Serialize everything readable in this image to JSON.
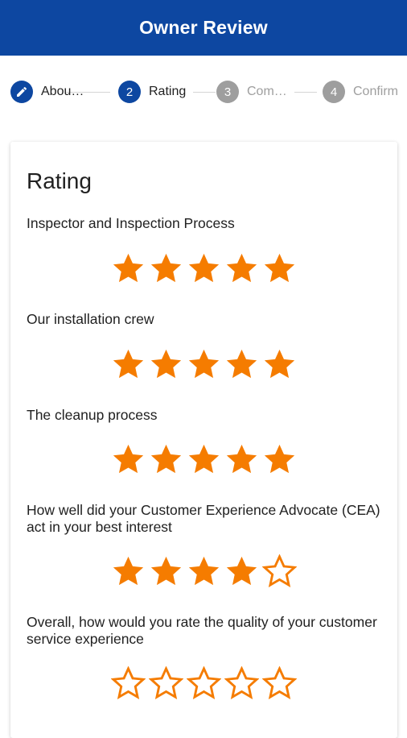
{
  "header": {
    "title": "Owner Review"
  },
  "stepper": {
    "steps": [
      {
        "number": "",
        "label": "Abou…",
        "state": "completed"
      },
      {
        "number": "2",
        "label": "Rating",
        "state": "active"
      },
      {
        "number": "3",
        "label": "Com…",
        "state": "inactive"
      },
      {
        "number": "4",
        "label": "Confirm",
        "state": "inactive"
      }
    ]
  },
  "card": {
    "title": "Rating",
    "questions": [
      {
        "text": "Inspector and Inspection Process",
        "rating": 5,
        "max": 5
      },
      {
        "text": "Our installation crew",
        "rating": 5,
        "max": 5
      },
      {
        "text": "The cleanup process",
        "rating": 5,
        "max": 5
      },
      {
        "text": "How well did your Customer Experience Advocate (CEA) act in your best interest",
        "rating": 4,
        "max": 5
      },
      {
        "text": "Overall, how would you rate the quality of your customer service experience",
        "rating": 0,
        "max": 5
      }
    ]
  },
  "colors": {
    "primary": "#0d47a1",
    "star": "#f57c00",
    "inactive": "#9e9e9e"
  },
  "icons": {
    "completed_step": "pencil-icon",
    "filled_star": "star-filled-icon",
    "empty_star": "star-outline-icon"
  }
}
